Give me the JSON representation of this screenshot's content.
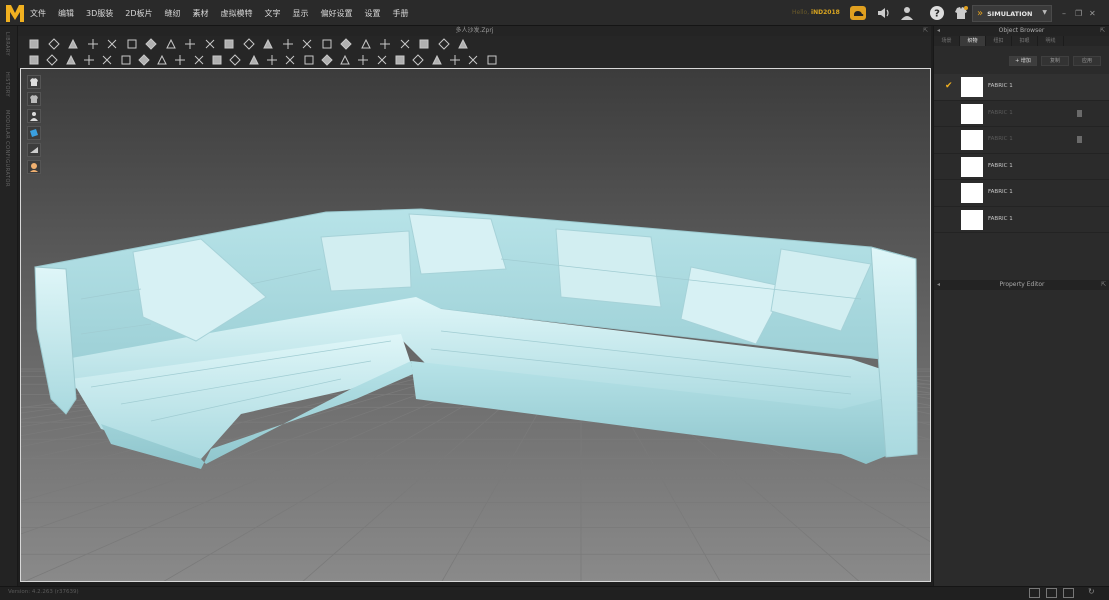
{
  "app": {
    "logo_letter": "M",
    "file_title": "多人沙发.Zprj",
    "version": "Version: 4.2.263 (r37639)"
  },
  "menu": [
    "文件",
    "编辑",
    "3D服装",
    "2D板片",
    "缝纫",
    "素材",
    "虚拟模特",
    "文字",
    "显示",
    "偏好设置",
    "设置",
    "手册"
  ],
  "user": {
    "hello": "Hello,",
    "name": "iND2018"
  },
  "mode": {
    "label": "SIMULATION"
  },
  "colors": {
    "accent": "#f0b020",
    "viewport_bg": "#555555",
    "fabric": "#c2ecf0"
  },
  "left_tabs": [
    "LIBRARY",
    "HISTORY",
    "MODULAR CONFIGURATOR"
  ],
  "object_browser": {
    "title": "Object Browser",
    "tabs": [
      "场景",
      "织物",
      "纽扣",
      "扣眼",
      "明线"
    ],
    "active_tab": 1,
    "buttons": [
      "+ 增加",
      "复制",
      "应用"
    ],
    "fabrics": [
      {
        "name": "FABRIC 1",
        "selected": true,
        "dim": false,
        "trash": false
      },
      {
        "name": "FABRIC 1",
        "selected": false,
        "dim": true,
        "trash": true
      },
      {
        "name": "FABRIC 1",
        "selected": false,
        "dim": true,
        "trash": true
      },
      {
        "name": "FABRIC 1",
        "selected": false,
        "dim": false,
        "trash": false
      },
      {
        "name": "FABRIC 1",
        "selected": false,
        "dim": false,
        "trash": false
      },
      {
        "name": "FABRIC 1",
        "selected": false,
        "dim": false,
        "trash": false
      }
    ]
  },
  "property_editor": {
    "title": "Property Editor"
  }
}
